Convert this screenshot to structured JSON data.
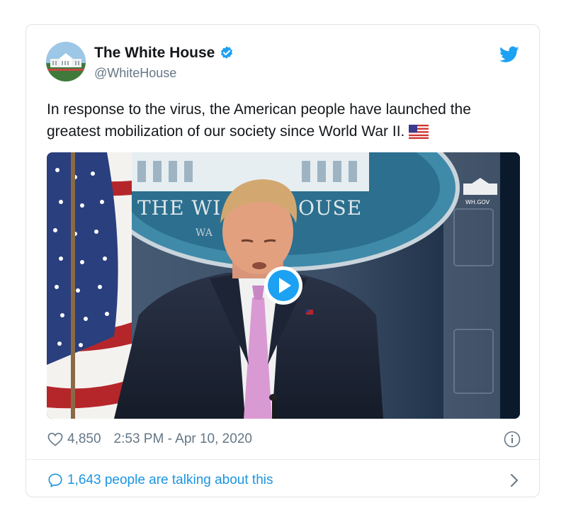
{
  "tweet": {
    "display_name": "The White House",
    "handle": "@WhiteHouse",
    "verified": true,
    "text": "In response to the virus, the American people have launched the greatest mobilization of our society since World War II.",
    "emoji": "us-flag",
    "media": {
      "type": "video",
      "seal_text": "THE WHITE HOUSE",
      "seal_subtext": "WA",
      "watermark": "WH.GOV"
    },
    "likes": "4,850",
    "timestamp": "2:53 PM - Apr 10, 2020",
    "talking": "1,643 people are talking about this"
  },
  "icons": {
    "verified": "verified-badge-icon",
    "brand": "twitter-bird-icon",
    "like": "heart-icon",
    "info": "info-icon",
    "reply": "speech-bubble-icon",
    "more": "chevron-right-icon",
    "play": "play-icon"
  },
  "colors": {
    "brand": "#1da1f2",
    "link": "#1b95e0",
    "text": "#14171a",
    "muted": "#657786",
    "border": "#dfe3e8"
  }
}
